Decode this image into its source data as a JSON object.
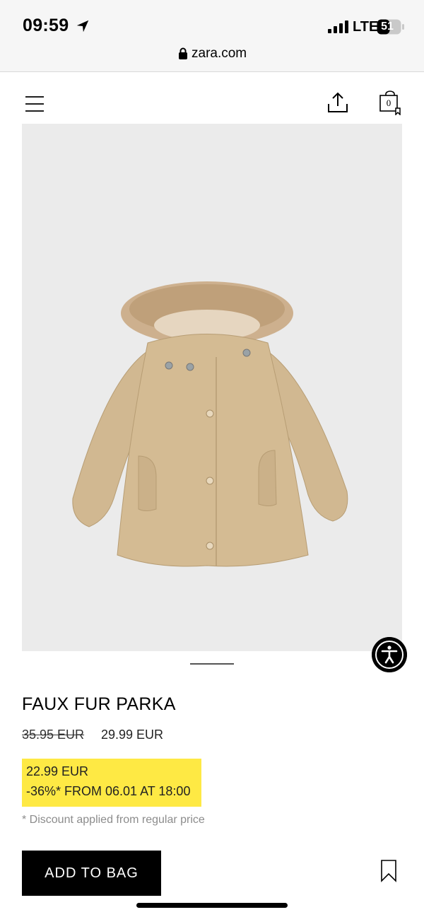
{
  "status_bar": {
    "time": "09:59",
    "network": "LTE",
    "battery": "51"
  },
  "browser": {
    "url": "zara.com"
  },
  "header": {
    "bag_count": "0",
    "icons": [
      "menu-icon",
      "share-icon",
      "shopping-bag-icon"
    ]
  },
  "product": {
    "title": "FAUX FUR PARKA",
    "old_price": "35.95 EUR",
    "price": "29.99 EUR",
    "promo": {
      "line1": "22.99 EUR",
      "line2": "-36%* FROM 06.01 AT 18:00",
      "color": "#fee944"
    },
    "disclaimer": "* Discount applied from regular price",
    "image_bg": "#ebebeb",
    "coat_color": "#d1b891"
  },
  "actions": {
    "add_to_bag": "ADD TO BAG"
  }
}
